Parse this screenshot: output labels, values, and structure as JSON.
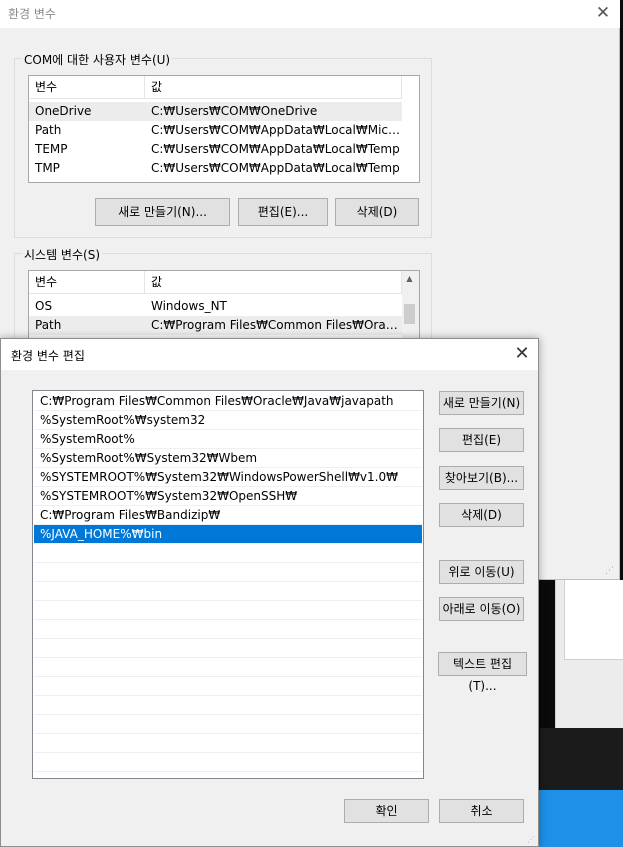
{
  "parent": {
    "title": "환경 변수",
    "close": "✕",
    "user_group_label": "COM에 대한 사용자 변수(U)",
    "user_vars": {
      "headers": [
        "변수",
        "값"
      ],
      "rows": [
        {
          "name": "OneDrive",
          "value": "C:₩Users₩COM₩OneDrive"
        },
        {
          "name": "Path",
          "value": "C:₩Users₩COM₩AppData₩Local₩Microsof..."
        },
        {
          "name": "TEMP",
          "value": "C:₩Users₩COM₩AppData₩Local₩Temp"
        },
        {
          "name": "TMP",
          "value": "C:₩Users₩COM₩AppData₩Local₩Temp"
        }
      ]
    },
    "user_buttons": {
      "new": "새로 만들기(N)...",
      "edit": "편집(E)...",
      "delete": "삭제(D)"
    },
    "system_group_label": "시스템 변수(S)",
    "system_vars": {
      "headers": [
        "변수",
        "값"
      ],
      "rows": [
        {
          "name": "OS",
          "value": "Windows_NT"
        },
        {
          "name": "Path",
          "value": "C:₩Program Files₩Common Files₩Oracle₩..."
        }
      ]
    }
  },
  "child": {
    "title": "환경 변수 편집",
    "close": "✕",
    "paths": [
      "C:₩Program Files₩Common Files₩Oracle₩Java₩javapath",
      "%SystemRoot%₩system32",
      "%SystemRoot%",
      "%SystemRoot%₩System32₩Wbem",
      "%SYSTEMROOT%₩System32₩WindowsPowerShell₩v1.0₩",
      "%SYSTEMROOT%₩System32₩OpenSSH₩",
      "C:₩Program Files₩Bandizip₩",
      "%JAVA_HOME%₩bin"
    ],
    "selected_index": 7,
    "buttons": {
      "new": "새로 만들기(N)",
      "edit": "편집(E)",
      "browse": "찾아보기(B)...",
      "delete": "삭제(D)",
      "move_up": "위로 이동(U)",
      "move_down": "아래로 이동(O)",
      "edit_text": "텍스트 편집(T)...",
      "ok": "확인",
      "cancel": "취소"
    }
  },
  "colors": {
    "selection": "#0078d7",
    "dialog_bg": "#f0f0f0",
    "button_bg": "#e1e1e1",
    "taskbar_blue": "#1e90e8"
  }
}
